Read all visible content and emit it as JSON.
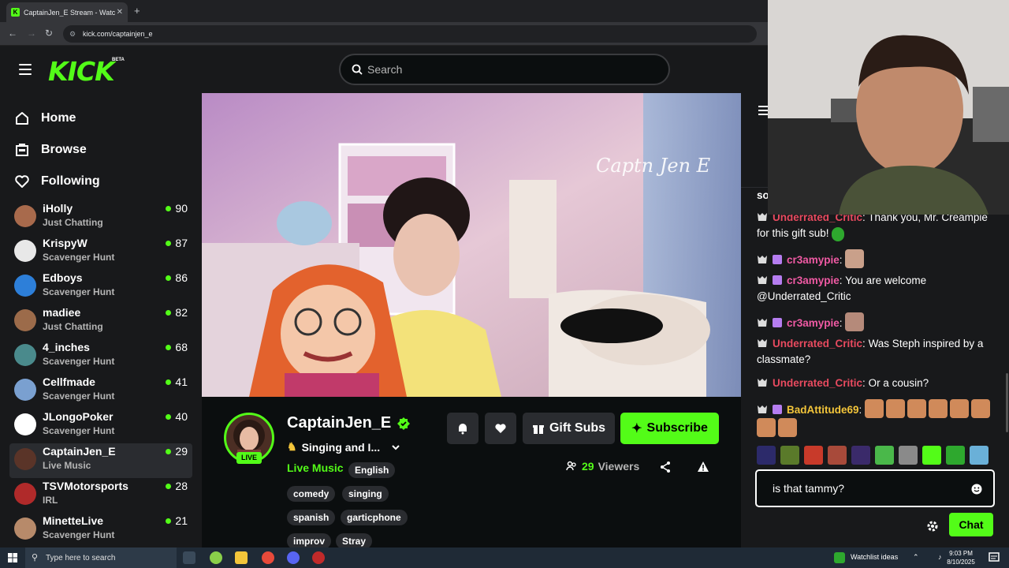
{
  "browser": {
    "tab_title": "CaptainJen_E Stream - Watc",
    "tab_favicon": "K",
    "url": "kick.com/captainjen_e"
  },
  "header": {
    "logo": "KICK",
    "logo_badge": "BETA",
    "search_placeholder": "Search"
  },
  "sidebar": {
    "nav": [
      {
        "label": "Home",
        "icon": "home-icon"
      },
      {
        "label": "Browse",
        "icon": "browse-icon"
      },
      {
        "label": "Following",
        "icon": "heart-icon"
      }
    ],
    "channels": [
      {
        "name": "iHolly",
        "category": "Just Chatting",
        "viewers": "90",
        "color": "#a86a4c"
      },
      {
        "name": "KrispyW",
        "category": "Scavenger Hunt",
        "viewers": "87",
        "color": "#e8e8e8"
      },
      {
        "name": "Edboys",
        "category": "Scavenger Hunt",
        "viewers": "86",
        "color": "#2d7fd9"
      },
      {
        "name": "madiee",
        "category": "Just Chatting",
        "viewers": "82",
        "color": "#9c6b4a"
      },
      {
        "name": "4_inches",
        "category": "Scavenger Hunt",
        "viewers": "68",
        "color": "#4a8a8c"
      },
      {
        "name": "Cellfmade",
        "category": "Scavenger Hunt",
        "viewers": "41",
        "color": "#7aa0d0"
      },
      {
        "name": "JLongoPoker",
        "category": "Scavenger Hunt",
        "viewers": "40",
        "color": "#ffffff"
      },
      {
        "name": "CaptainJen_E",
        "category": "Live Music",
        "viewers": "29",
        "color": "#5a3428"
      },
      {
        "name": "TSVMotorsports",
        "category": "IRL",
        "viewers": "28",
        "color": "#b02a2a"
      },
      {
        "name": "MinetteLive",
        "category": "Scavenger Hunt",
        "viewers": "21",
        "color": "#b78a6a"
      }
    ]
  },
  "stream": {
    "channel_name": "CaptainJen_E",
    "live_label": "LIVE",
    "title": "Singing and I...",
    "category": "Live Music",
    "tags": [
      "English",
      "comedy",
      "singing",
      "spanish",
      "garticphone",
      "improv",
      "Stray"
    ],
    "viewer_count": "29",
    "viewer_label": "Viewers",
    "gift_label": "Gift Subs",
    "subscribe_label": "Subscribe"
  },
  "chat": {
    "partial_top": "so",
    "messages": [
      {
        "user": "Underrated_Critic",
        "color": "#e84a5f",
        "mod": true,
        "sub": false,
        "text": "Thank you, Mr. Creampie for this gift sub!"
      },
      {
        "user": "cr3amypie",
        "color": "#f05aa4",
        "mod": true,
        "sub": true,
        "text": ""
      },
      {
        "user": "cr3amypie",
        "color": "#f05aa4",
        "mod": true,
        "sub": true,
        "text": "You are welcome @Underrated_Critic"
      },
      {
        "user": "cr3amypie",
        "color": "#f05aa4",
        "mod": true,
        "sub": true,
        "text": ""
      },
      {
        "user": "Underrated_Critic",
        "color": "#e84a5f",
        "mod": true,
        "sub": false,
        "text": "Was Steph inspired by a classmate?"
      },
      {
        "user": "Underrated_Critic",
        "color": "#e84a5f",
        "mod": true,
        "sub": false,
        "text": "Or a cousin?"
      },
      {
        "user": "BadAttitude69",
        "color": "#f3c53a",
        "mod": true,
        "sub": true,
        "text": ""
      }
    ],
    "input_value": "is that tammy?",
    "send_label": "Chat"
  },
  "taskbar": {
    "search_placeholder": "Type here to search",
    "notification": "Watchlist ideas",
    "time": "9:03 PM",
    "date": "8/10/2025"
  },
  "colors": {
    "accent": "#53fc18",
    "background": "#0b0e0f",
    "panel": "#18191b"
  }
}
